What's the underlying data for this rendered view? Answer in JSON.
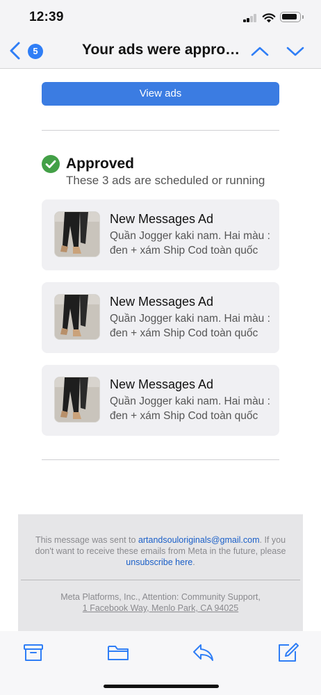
{
  "status_bar": {
    "time": "12:39"
  },
  "nav": {
    "unread_count": "5",
    "title": "Your ads were approved"
  },
  "email": {
    "view_ads_label": "View ads",
    "approved": {
      "title": "Approved",
      "subtitle": "These 3 ads are scheduled or running"
    },
    "ads": [
      {
        "title": "New Messages Ad",
        "description": "Quần Jogger kaki nam. Hai màu : đen + xám Ship Cod toàn quốc"
      },
      {
        "title": "New Messages Ad",
        "description": "Quần Jogger kaki nam. Hai màu : đen + xám Ship Cod toàn quốc"
      },
      {
        "title": "New Messages Ad",
        "description": "Quần Jogger kaki nam. Hai màu : đen + xám Ship Cod toàn quốc"
      }
    ]
  },
  "footer": {
    "msg_part1": "This message was sent to ",
    "email": "artandsouloriginals@gmail.com",
    "msg_part2": ". If you don't want to receive these emails from Meta in the future, please ",
    "unsubscribe_label": "unsubscribe here",
    "msg_part3": ".",
    "address_part1": "Meta Platforms, Inc., Attention: Community Support, ",
    "address_link": "1 Facebook Way, Menlo Park, CA 94025"
  },
  "toolbar": {
    "icons": [
      "archive-icon",
      "folder-icon",
      "reply-icon",
      "compose-icon"
    ]
  },
  "colors": {
    "accent": "#2f7ef6",
    "button": "#3b7ce2",
    "approved_green": "#43a047",
    "link": "#1a5fc8"
  }
}
